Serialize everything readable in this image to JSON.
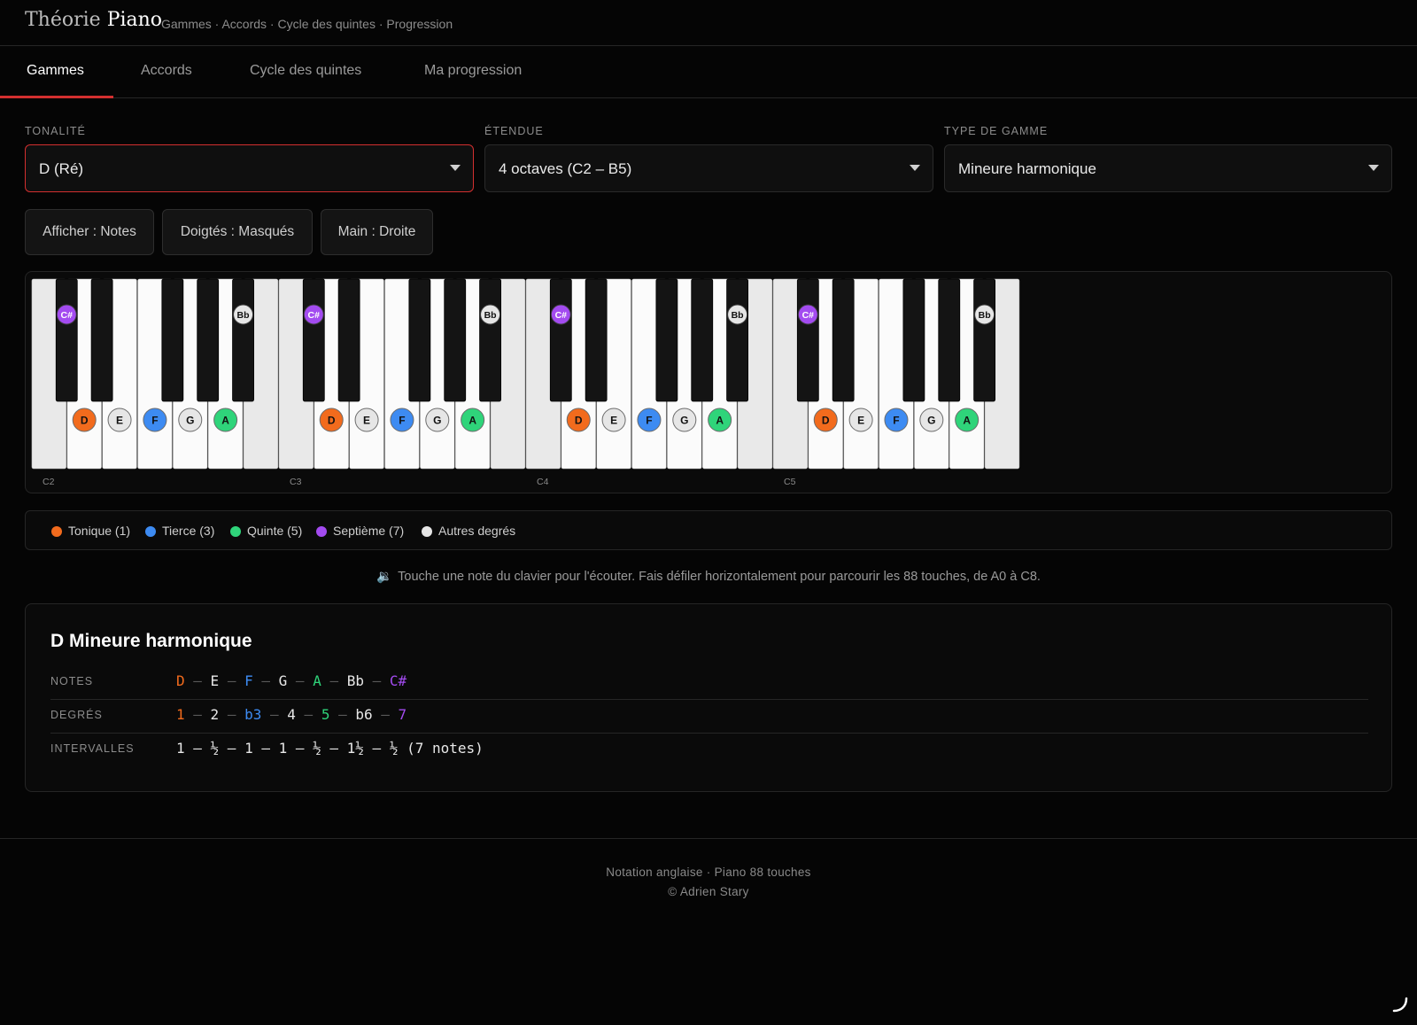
{
  "header": {
    "brand_light": "Théorie",
    "brand_bold": "Piano",
    "breadcrumb": "Gammes · Accords · Cycle des quintes · Progression"
  },
  "tabs": [
    {
      "label": "Gammes",
      "active": true
    },
    {
      "label": "Accords",
      "active": false
    },
    {
      "label": "Cycle des quintes",
      "active": false
    },
    {
      "label": "Ma progression",
      "active": false
    }
  ],
  "controls": {
    "tonalite": {
      "label": "Tonalité",
      "value": "D (Ré)"
    },
    "etendue": {
      "label": "Étendue",
      "value": "4 octaves (C2 – B5)"
    },
    "type": {
      "label": "Type de gamme",
      "value": "Mineure harmonique"
    }
  },
  "buttons": {
    "afficher": "Afficher : Notes",
    "doigtes": "Doigtés : Masqués",
    "main": "Main : Droite"
  },
  "keyboard": {
    "octaves": [
      "C2",
      "C3",
      "C4",
      "C5"
    ],
    "white_marks": [
      {
        "index": 1,
        "note": "D",
        "role": "tonic"
      },
      {
        "index": 2,
        "note": "E",
        "role": "other"
      },
      {
        "index": 3,
        "note": "F",
        "role": "third"
      },
      {
        "index": 4,
        "note": "G",
        "role": "other"
      },
      {
        "index": 5,
        "note": "A",
        "role": "fifth"
      }
    ],
    "black_marks": [
      {
        "after_white": 0,
        "note": "C#",
        "role": "seventh"
      },
      {
        "after_white": 5,
        "note": "Bb",
        "role": "other"
      }
    ]
  },
  "legend": [
    {
      "label": "Tonique (1)",
      "color": "#f26b1d"
    },
    {
      "label": "Tierce (3)",
      "color": "#3d8bf2"
    },
    {
      "label": "Quinte (5)",
      "color": "#2fd47a"
    },
    {
      "label": "Septième (7)",
      "color": "#a34bf0"
    },
    {
      "label": "Autres degrés",
      "color": "#e6e6e6"
    }
  ],
  "hint": {
    "icon": "speaker-icon",
    "text": "Touche une note du clavier pour l'écouter. Fais défiler horizontalement pour parcourir les 88 touches, de A0 à C8."
  },
  "scale": {
    "title": "D Mineure harmonique",
    "notes_label": "Notes",
    "degrees_label": "Degrés",
    "intervals_label": "Intervalles",
    "notes": [
      {
        "t": "D",
        "c": "#f26b1d"
      },
      {
        "t": "E",
        "c": "#e8e8e8"
      },
      {
        "t": "F",
        "c": "#3d8bf2"
      },
      {
        "t": "G",
        "c": "#e8e8e8"
      },
      {
        "t": "A",
        "c": "#2fd47a"
      },
      {
        "t": "Bb",
        "c": "#e8e8e8"
      },
      {
        "t": "C#",
        "c": "#a34bf0"
      }
    ],
    "degrees": [
      {
        "t": "1",
        "c": "#f26b1d"
      },
      {
        "t": "2",
        "c": "#e8e8e8"
      },
      {
        "t": "b3",
        "c": "#3d8bf2"
      },
      {
        "t": "4",
        "c": "#e8e8e8"
      },
      {
        "t": "5",
        "c": "#2fd47a"
      },
      {
        "t": "b6",
        "c": "#e8e8e8"
      },
      {
        "t": "7",
        "c": "#a34bf0"
      }
    ],
    "intervals": "1 — ½ — 1 — 1 — ½ — 1½ — ½ (7 notes)"
  },
  "footer": {
    "line1": "Notation anglaise · Piano 88 touches",
    "line2": "© Adrien Stary"
  },
  "colors": {
    "tonic": "#f26b1d",
    "third": "#3d8bf2",
    "fifth": "#2fd47a",
    "seventh": "#a34bf0",
    "other": "#e6e6e6",
    "accent": "#d32f2f"
  }
}
